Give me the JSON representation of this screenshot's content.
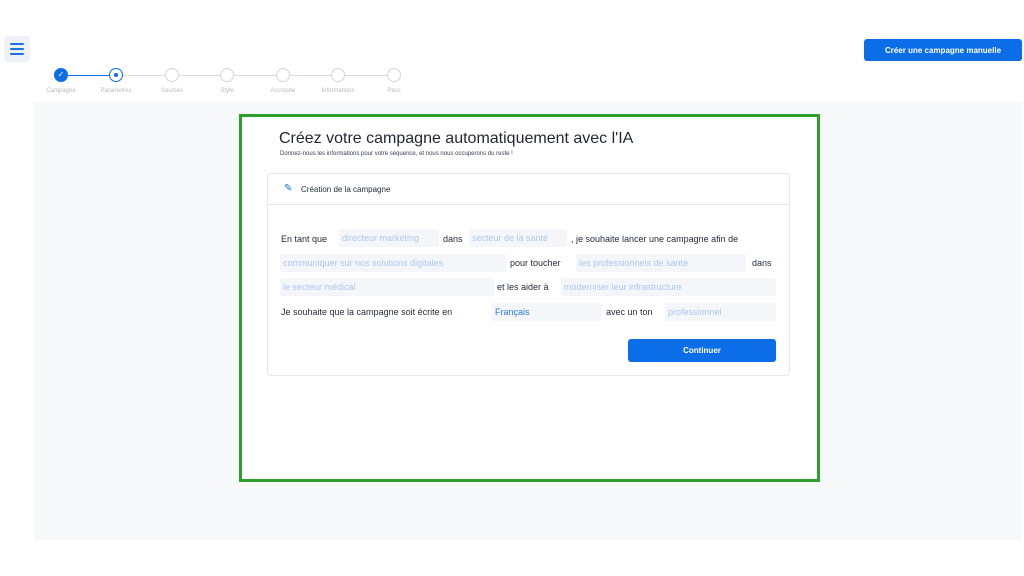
{
  "header": {
    "menu_icon": "hamburger-menu-icon",
    "manual_campaign_button": "Créer une campagne manuelle",
    "accent_color": "#0b6ee8"
  },
  "stepper": {
    "steps": [
      {
        "label": "Campagne",
        "status": "done"
      },
      {
        "label": "Paramètres",
        "status": "active"
      },
      {
        "label": "Sources",
        "status": "pending"
      },
      {
        "label": "Style",
        "status": "pending"
      },
      {
        "label": "Accroche",
        "status": "pending"
      },
      {
        "label": "Informations",
        "status": "pending"
      },
      {
        "label": "Pass",
        "status": "pending"
      }
    ]
  },
  "main": {
    "title": "Créez votre campagne automatiquement avec l'IA",
    "subtitle": "Donnez-nous les informations pour votre séquence, et nous nous occuperons du reste !",
    "highlight_color": "#2ca02c"
  },
  "card": {
    "icon": "pencil-icon",
    "header": "Création de la campagne",
    "sentence": {
      "t1": "En tant que",
      "role_placeholder": "directeur marketing",
      "t2": "dans",
      "sector_placeholder": "secteur de la santé",
      "t3": ", je souhaite lancer une campagne afin de",
      "goal_placeholder": "communiquer sur nos solutions digitales",
      "t4": "pour toucher",
      "target_placeholder": "les professionnels de santé",
      "t5": "dans",
      "domain_placeholder": "le secteur médical",
      "t6": "et les aider à",
      "help_placeholder": "moderniser leur infrastructure",
      "t7": "Je souhaite que la campagne soit écrite en",
      "language_value": "Français",
      "t8": "avec un ton",
      "tone_placeholder": "professionnel"
    },
    "continue_label": "Continuer"
  }
}
